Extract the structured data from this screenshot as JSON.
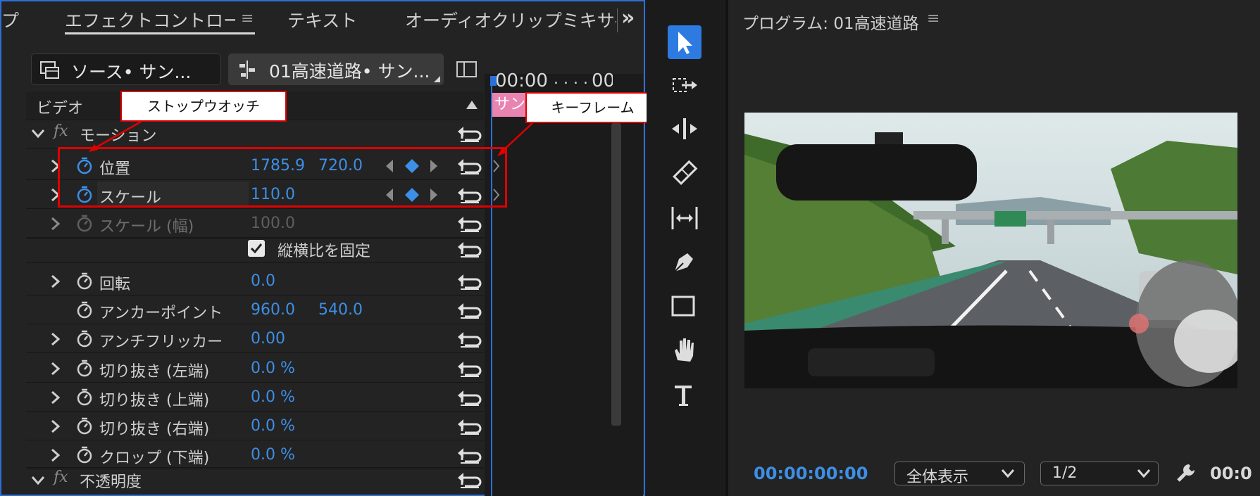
{
  "tabs": {
    "partial_left": "プ",
    "effect_controls": "エフェクトコントロー/",
    "text": "テキスト",
    "audio_mixer": "オーディオクリップミキサ-",
    "overflow": "»",
    "menu": "≡"
  },
  "clips": {
    "source": "ソース• サン...",
    "sequence": "01高速道路• サン..."
  },
  "timeline": {
    "timecode_start": "00:00",
    "timecode_dots": ". . . .",
    "timecode_next": "00",
    "clip_label": "サン"
  },
  "section": {
    "video": "ビデオ",
    "motion": "モーション",
    "opacity": "不透明度",
    "fx": "fx"
  },
  "properties": [
    {
      "label": "位置",
      "v1": "1785.9",
      "v2": "720.0",
      "expandable": true,
      "active": true,
      "keyframe": true
    },
    {
      "label": "スケール",
      "v1": "110.0",
      "v2": "",
      "expandable": true,
      "active": true,
      "keyframe": true
    },
    {
      "label": "スケール (幅)",
      "v1": "100.0",
      "v2": "",
      "expandable": true,
      "active": false,
      "keyframe": false
    },
    {
      "label": "回転",
      "v1": "0.0",
      "v2": "",
      "expandable": true,
      "active": false,
      "keyframe": false
    },
    {
      "label": "アンカーポイント",
      "v1": "960.0",
      "v2": "540.0",
      "expandable": false,
      "active": false,
      "keyframe": false
    },
    {
      "label": "アンチフリッカー",
      "v1": "0.00",
      "v2": "",
      "expandable": true,
      "active": false,
      "keyframe": false
    },
    {
      "label": "切り抜き (左端)",
      "v1": "0.0 %",
      "v2": "",
      "expandable": true,
      "active": false,
      "keyframe": false
    },
    {
      "label": "切り抜き (上端)",
      "v1": "0.0 %",
      "v2": "",
      "expandable": true,
      "active": false,
      "keyframe": false
    },
    {
      "label": "切り抜き (右端)",
      "v1": "0.0 %",
      "v2": "",
      "expandable": true,
      "active": false,
      "keyframe": false
    },
    {
      "label": "クロップ (下端)",
      "v1": "0.0 %",
      "v2": "",
      "expandable": true,
      "active": false,
      "keyframe": false
    }
  ],
  "uniform_scale": {
    "label": "縦横比を固定",
    "checked": true
  },
  "callouts": {
    "stopwatch": "ストップウオッチ",
    "keyframe": "キーフレーム"
  },
  "program": {
    "title": "プログラム: 01高速道路",
    "menu": "≡",
    "timecode": "00:00:00:00",
    "zoom": "全体表示",
    "resolution": "1/2",
    "timecode_right": "00:0"
  },
  "tools": [
    "selection-tool-icon",
    "track-select-tool-icon",
    "ripple-edit-tool-icon",
    "razor-tool-icon",
    "slip-tool-icon",
    "pen-tool-icon",
    "rectangle-tool-icon",
    "hand-tool-icon",
    "type-tool-icon"
  ],
  "colors": {
    "accent": "#2d6fd9",
    "value_blue": "#3d8fe6",
    "callout_border": "#e00000",
    "clip_pink": "#e984b1"
  }
}
